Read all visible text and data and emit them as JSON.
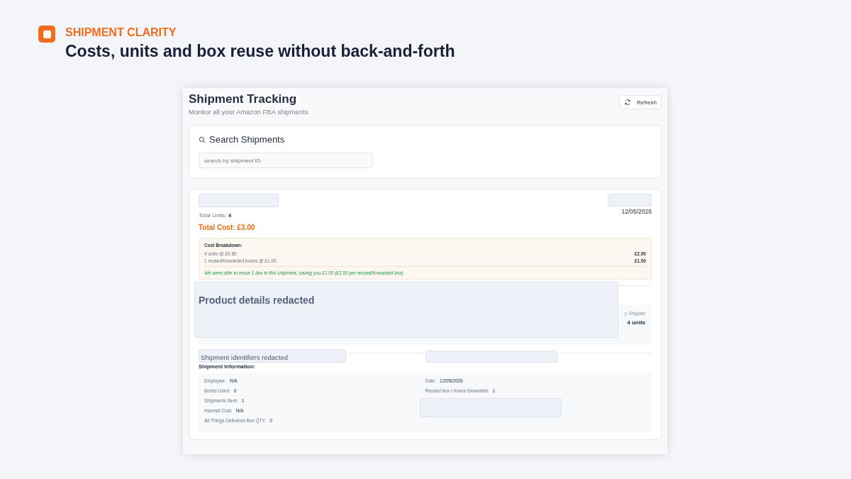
{
  "header": {
    "eyebrow": "SHIPMENT CLARITY",
    "headline": "Costs, units and box reuse without back-and-forth"
  },
  "app": {
    "title": "Shipment Tracking",
    "subtitle": "Monitor all your Amazon FBA shipments",
    "refresh_button": "Refresh",
    "search": {
      "heading": "Search Shipments",
      "placeholder": "search by shipment ID"
    },
    "shipment": {
      "date": "12/05/2026",
      "total_units_label": "Total Units:",
      "total_units": "4",
      "total_cost": "Total Cost: £3.00",
      "breakdown": {
        "heading": "Cost Breakdown:",
        "lines": [
          {
            "label": "4 units @ £0.50",
            "amount": "£2.00"
          },
          {
            "label": "1 reused/forwarded boxes @ £1.00",
            "amount": "£1.00"
          }
        ],
        "note": "We were able to reuse 1 box in this shipment, saving you £1.50 (£1.50 per reused/forwarded box)"
      },
      "product": {
        "redaction": "Product details redacted",
        "qty_label": "y Shipped",
        "qty": "4 units"
      },
      "identifiers_redaction": "Shipment identifiers redacted",
      "info_heading": "Shipment Information:",
      "info_left": [
        {
          "label": "Employee:",
          "value": "N/A"
        },
        {
          "label": "Boxes Used:",
          "value": "0"
        },
        {
          "label": "Shipments Sent:",
          "value": "1"
        },
        {
          "label": "Hazmat Cost:",
          "value": "N/A"
        },
        {
          "label": "All Things Delivered Box QTY:",
          "value": "0"
        }
      ],
      "info_right": [
        {
          "label": "Date:",
          "value": "12/05/2026"
        },
        {
          "label": "Reused box / boxes forwarded:",
          "value": "1"
        }
      ]
    }
  }
}
